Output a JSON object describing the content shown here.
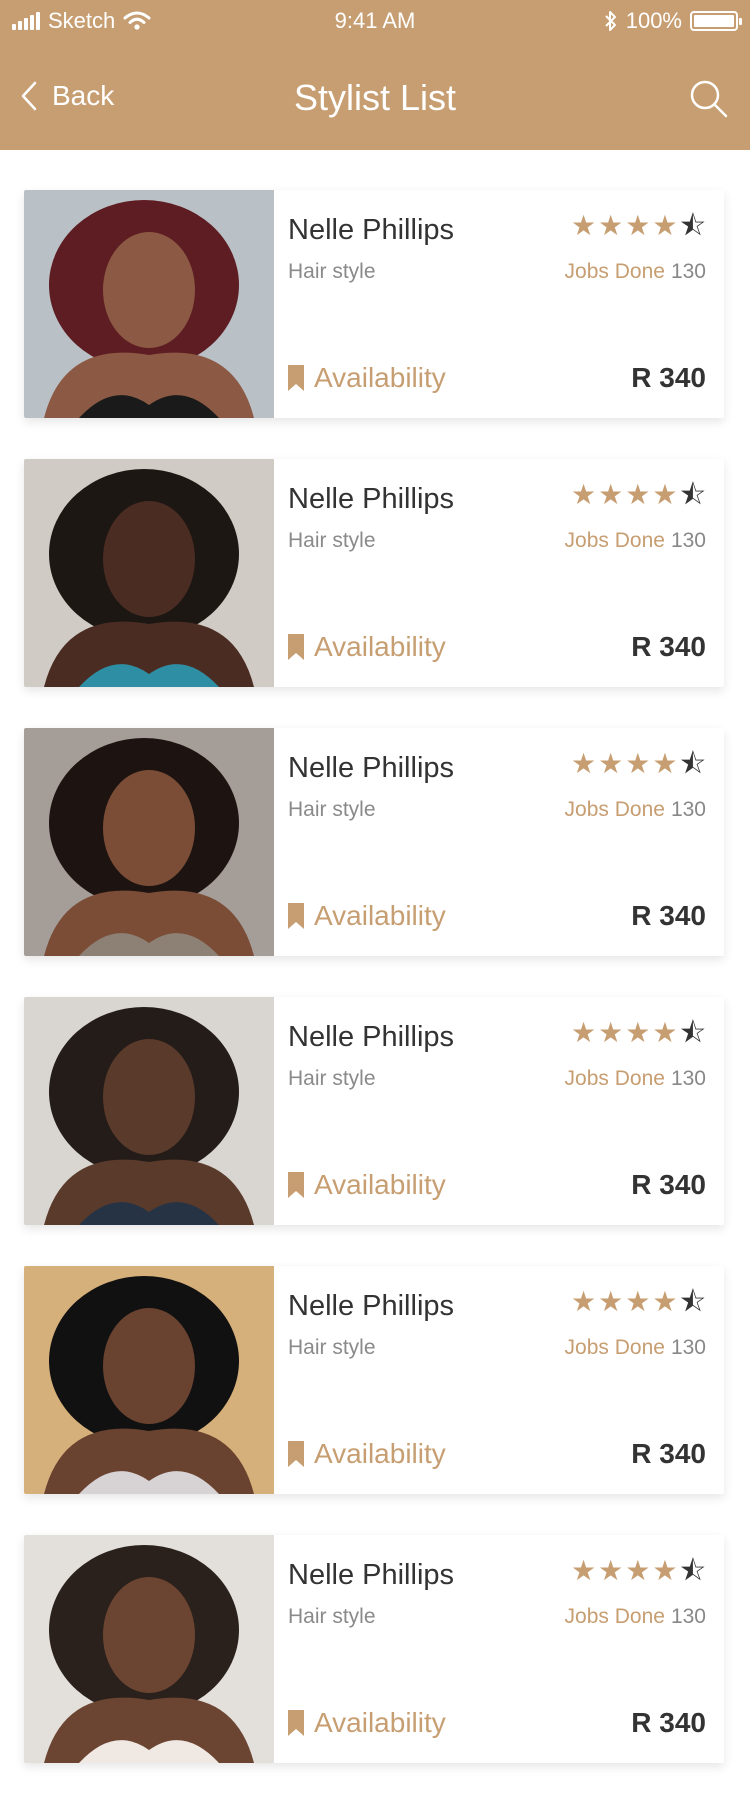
{
  "status_bar": {
    "carrier": "Sketch",
    "time": "9:41 AM",
    "battery": "100%"
  },
  "header": {
    "back_label": "Back",
    "title": "Stylist List"
  },
  "colors": {
    "accent": "#c79e72",
    "text_dark": "#333333",
    "text_muted": "#8a8a8a"
  },
  "icons": {
    "back": "chevron-left-icon",
    "search": "search-icon",
    "availability": "bookmark-icon",
    "star": "star-icon"
  },
  "stylists": [
    {
      "name": "Nelle Phillips",
      "category": "Hair style",
      "rating": 4.5,
      "jobs_label": "Jobs Done",
      "jobs_count": "130",
      "availability_label": "Availability",
      "price": "R 340"
    },
    {
      "name": "Nelle Phillips",
      "category": "Hair style",
      "rating": 4.5,
      "jobs_label": "Jobs Done",
      "jobs_count": "130",
      "availability_label": "Availability",
      "price": "R 340"
    },
    {
      "name": "Nelle Phillips",
      "category": "Hair style",
      "rating": 4.5,
      "jobs_label": "Jobs Done",
      "jobs_count": "130",
      "availability_label": "Availability",
      "price": "R 340"
    },
    {
      "name": "Nelle Phillips",
      "category": "Hair style",
      "rating": 4.5,
      "jobs_label": "Jobs Done",
      "jobs_count": "130",
      "availability_label": "Availability",
      "price": "R 340"
    },
    {
      "name": "Nelle Phillips",
      "category": "Hair style",
      "rating": 4.5,
      "jobs_label": "Jobs Done",
      "jobs_count": "130",
      "availability_label": "Availability",
      "price": "R 340"
    },
    {
      "name": "Nelle Phillips",
      "category": "Hair style",
      "rating": 4.5,
      "jobs_label": "Jobs Done",
      "jobs_count": "130",
      "availability_label": "Availability",
      "price": "R 340"
    }
  ]
}
